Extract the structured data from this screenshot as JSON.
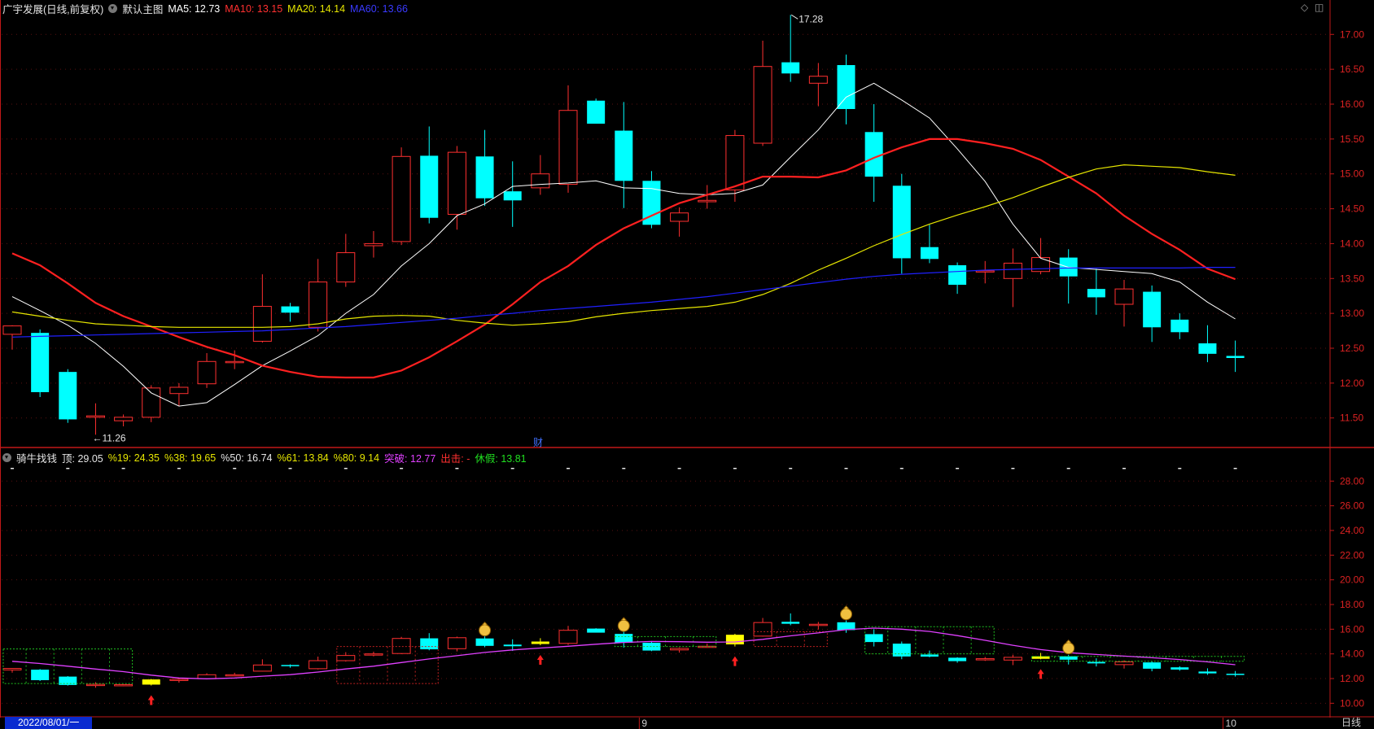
{
  "main_header": {
    "stock_title": "广宇发展(日线,前复权)",
    "template_name": "默认主图",
    "ma5_label": "MA5: 12.73",
    "ma10_label": "MA10: 13.15",
    "ma20_label": "MA20: 14.14",
    "ma60_label": "MA60: 13.66",
    "colors": {
      "ma5": "#ffffff",
      "ma10": "#ff2020",
      "ma20": "#e6e600",
      "ma60": "#2020ff"
    }
  },
  "sub_header": {
    "indicator_name": "骑牛找钱",
    "top_label": "顶: 29.05",
    "p19_label": "%19: 24.35",
    "p38_label": "%38: 19.65",
    "p50_label": "%50: 16.74",
    "p61_label": "%61: 13.84",
    "p80_label": "%80: 9.14",
    "breakout_label": "突破: 12.77",
    "exit_label": "出击: -",
    "rest_label": "休假: 13.81"
  },
  "footer": {
    "date_label": "2022/08/01/一",
    "period_label": "日线",
    "month_labels": [
      "9",
      "10"
    ]
  },
  "annotations": {
    "max_label": "17.28",
    "min_label": "←11.26",
    "finance_mark": "财"
  },
  "chart_data": [
    {
      "type": "candlestick",
      "title": "广宇发展(日线,前复权)",
      "y_ticks": [
        "17.00",
        "16.50",
        "16.00",
        "15.50",
        "15.00",
        "14.50",
        "14.00",
        "13.50",
        "13.00",
        "12.50",
        "12.00",
        "11.50"
      ],
      "ylim": [
        11.1,
        17.4
      ],
      "grid": true,
      "ohlc": [
        [
          12.7,
          12.83,
          12.48,
          12.82
        ],
        [
          12.72,
          12.77,
          11.8,
          11.87
        ],
        [
          12.16,
          12.2,
          11.43,
          11.48
        ],
        [
          11.51,
          11.71,
          11.26,
          11.53
        ],
        [
          11.46,
          11.55,
          11.38,
          11.51
        ],
        [
          11.51,
          11.97,
          11.44,
          11.93
        ],
        [
          11.85,
          12.0,
          11.67,
          11.94
        ],
        [
          11.99,
          12.43,
          11.93,
          12.31
        ],
        [
          12.3,
          12.47,
          12.2,
          12.31
        ],
        [
          12.6,
          13.56,
          12.58,
          13.1
        ],
        [
          13.1,
          13.15,
          12.88,
          13.01
        ],
        [
          12.8,
          13.78,
          12.74,
          13.45
        ],
        [
          13.45,
          14.14,
          13.38,
          13.87
        ],
        [
          13.97,
          14.18,
          13.8,
          14.0
        ],
        [
          14.03,
          15.38,
          13.98,
          15.25
        ],
        [
          15.26,
          15.68,
          14.29,
          14.37
        ],
        [
          14.42,
          15.4,
          14.2,
          15.31
        ],
        [
          15.25,
          15.63,
          14.54,
          14.65
        ],
        [
          14.75,
          15.18,
          14.24,
          14.62
        ],
        [
          14.8,
          15.27,
          14.7,
          15.0
        ],
        [
          14.85,
          16.27,
          14.73,
          15.91
        ],
        [
          16.05,
          16.08,
          15.74,
          15.72
        ],
        [
          15.62,
          16.03,
          14.51,
          14.9
        ],
        [
          14.9,
          15.04,
          14.22,
          14.27
        ],
        [
          14.32,
          14.52,
          14.1,
          14.44
        ],
        [
          14.6,
          14.84,
          14.5,
          14.62
        ],
        [
          14.77,
          15.63,
          14.6,
          15.55
        ],
        [
          15.44,
          16.91,
          15.4,
          16.54
        ],
        [
          16.6,
          17.28,
          16.32,
          16.44
        ],
        [
          16.3,
          16.59,
          15.97,
          16.4
        ],
        [
          16.56,
          16.71,
          15.71,
          15.93
        ],
        [
          15.6,
          16.0,
          14.6,
          14.96
        ],
        [
          14.83,
          15.0,
          13.57,
          13.79
        ],
        [
          13.95,
          14.27,
          13.72,
          13.78
        ],
        [
          13.69,
          13.73,
          13.28,
          13.41
        ],
        [
          13.6,
          13.75,
          13.43,
          13.61
        ],
        [
          13.5,
          13.93,
          13.09,
          13.72
        ],
        [
          13.6,
          14.08,
          13.56,
          13.8
        ],
        [
          13.8,
          13.92,
          13.14,
          13.53
        ],
        [
          13.35,
          13.64,
          12.98,
          13.23
        ],
        [
          13.13,
          13.48,
          12.81,
          13.35
        ],
        [
          13.31,
          13.4,
          12.59,
          12.8
        ],
        [
          12.91,
          13.0,
          12.63,
          12.73
        ],
        [
          12.57,
          12.83,
          12.3,
          12.42
        ],
        [
          12.39,
          12.61,
          12.16,
          12.36
        ]
      ],
      "series": [
        {
          "name": "MA5",
          "color": "#ffffff",
          "values": [
            13.24,
            13.04,
            12.83,
            12.57,
            12.24,
            11.86,
            11.67,
            11.72,
            11.98,
            12.25,
            12.46,
            12.68,
            13.0,
            13.27,
            13.68,
            14.0,
            14.4,
            14.57,
            14.82,
            14.85,
            14.87,
            14.9,
            14.8,
            14.79,
            14.72,
            14.7,
            14.72,
            14.84,
            15.24,
            15.63,
            16.1,
            16.3,
            16.06,
            15.8,
            15.36,
            14.89,
            14.28,
            13.79,
            13.66,
            13.63,
            13.6,
            13.57,
            13.45,
            13.16,
            12.92
          ]
        },
        {
          "name": "MA10",
          "color": "#ff2020",
          "values": [
            13.86,
            13.69,
            13.43,
            13.15,
            12.96,
            12.81,
            12.66,
            12.52,
            12.4,
            12.25,
            12.16,
            12.09,
            12.08,
            12.08,
            12.18,
            12.37,
            12.6,
            12.84,
            13.13,
            13.45,
            13.68,
            13.98,
            14.22,
            14.4,
            14.58,
            14.7,
            14.82,
            14.96,
            14.96,
            14.95,
            15.05,
            15.23,
            15.38,
            15.5,
            15.5,
            15.44,
            15.36,
            15.2,
            14.96,
            14.72,
            14.4,
            14.14,
            13.91,
            13.64,
            13.49
          ]
        },
        {
          "name": "MA20",
          "color": "#e6e600",
          "values": [
            13.02,
            12.96,
            12.9,
            12.85,
            12.83,
            12.81,
            12.8,
            12.8,
            12.8,
            12.8,
            12.81,
            12.85,
            12.92,
            12.96,
            12.97,
            12.96,
            12.9,
            12.86,
            12.83,
            12.85,
            12.88,
            12.95,
            13.0,
            13.04,
            13.07,
            13.1,
            13.16,
            13.27,
            13.43,
            13.62,
            13.79,
            13.97,
            14.13,
            14.28,
            14.41,
            14.53,
            14.66,
            14.81,
            14.95,
            15.07,
            15.13,
            15.11,
            15.09,
            15.03,
            14.98
          ]
        },
        {
          "name": "MA60",
          "color": "#2020ff",
          "values": [
            12.66,
            12.67,
            12.68,
            12.69,
            12.7,
            12.71,
            12.72,
            12.73,
            12.74,
            12.75,
            12.77,
            12.79,
            12.81,
            12.84,
            12.87,
            12.9,
            12.93,
            12.97,
            13.0,
            13.04,
            13.07,
            13.1,
            13.13,
            13.16,
            13.2,
            13.24,
            13.29,
            13.34,
            13.39,
            13.44,
            13.49,
            13.53,
            13.56,
            13.58,
            13.6,
            13.62,
            13.63,
            13.64,
            13.65,
            13.65,
            13.65,
            13.65,
            13.65,
            13.66,
            13.66
          ]
        }
      ]
    },
    {
      "type": "indicator",
      "title": "骑牛找钱",
      "y_ticks": [
        "28.00",
        "26.00",
        "24.00",
        "22.00",
        "20.00",
        "18.00",
        "16.00",
        "14.00",
        "12.00",
        "10.00"
      ],
      "ylim": [
        9.1,
        29.8
      ],
      "grid": true,
      "money_bag_days": [
        17,
        22,
        30,
        38
      ],
      "red_arrow_days": [
        5,
        19,
        26,
        37
      ],
      "breakout_line": {
        "color": "#e040ff",
        "values": [
          13.4,
          13.22,
          13.0,
          12.77,
          12.56,
          12.28,
          12.05,
          11.98,
          12.05,
          12.19,
          12.32,
          12.53,
          12.78,
          13.0,
          13.3,
          13.59,
          13.85,
          14.12,
          14.32,
          14.47,
          14.62,
          14.78,
          14.93,
          15.01,
          14.99,
          14.95,
          14.97,
          15.18,
          15.46,
          15.7,
          15.96,
          16.09,
          16.0,
          15.82,
          15.48,
          15.1,
          14.7,
          14.35,
          14.1,
          13.95,
          13.82,
          13.69,
          13.54,
          13.35,
          13.12
        ]
      }
    }
  ]
}
